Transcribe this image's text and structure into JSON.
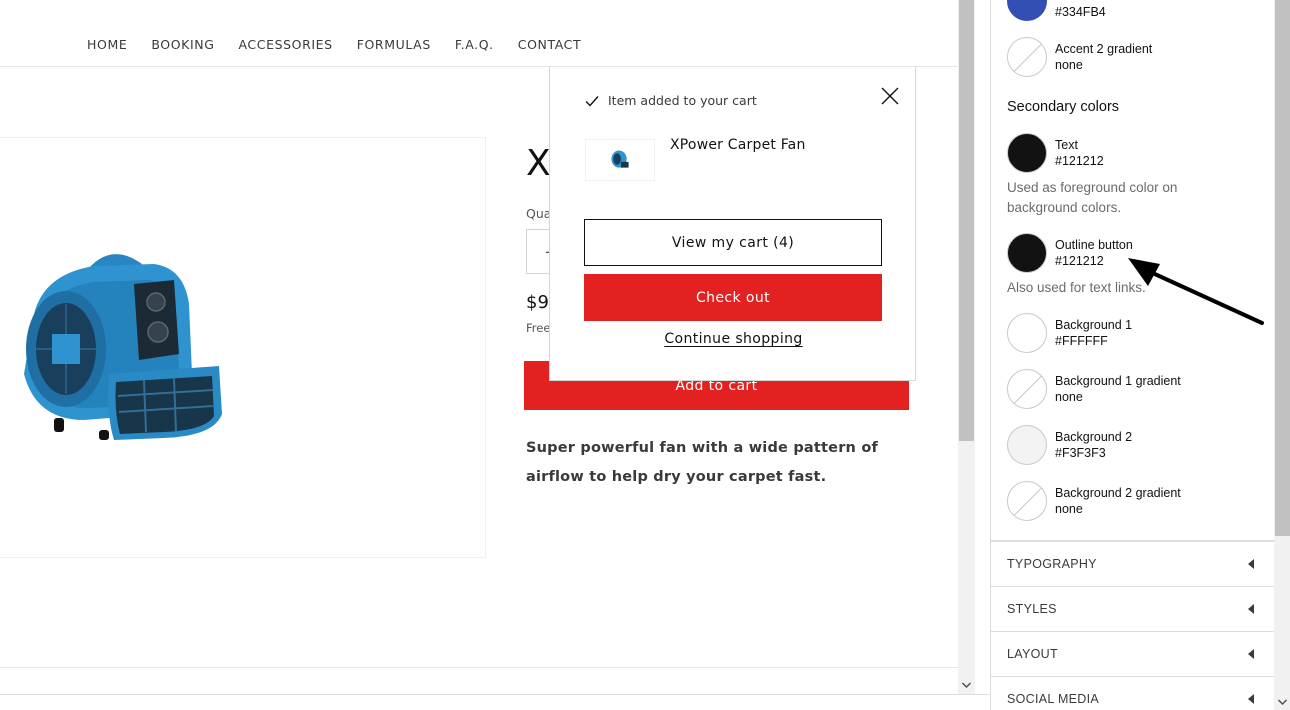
{
  "nav": {
    "items": [
      "HOME",
      "BOOKING",
      "ACCESSORIES",
      "FORMULAS",
      "F.A.Q.",
      "CONTACT"
    ]
  },
  "product": {
    "title_visible": "X",
    "quantity_label_visible": "Qua",
    "quantity_minus": "-",
    "price_visible": "$9.",
    "shipping_visible": "Free",
    "add_to_cart": "Add to cart",
    "description": "Super powerful fan with a wide pattern of airflow to help dry your carpet fast."
  },
  "cart_popup": {
    "added_message": "Item added to your cart",
    "item_name": "XPower Carpet Fan",
    "view_cart": "View my cart (4)",
    "checkout": "Check out",
    "continue_shopping": "Continue shopping"
  },
  "settings_panel": {
    "top_swatch_value": "#334FB4",
    "accent2_gradient": {
      "name": "Accent 2 gradient",
      "value": "none"
    },
    "secondary_heading": "Secondary colors",
    "text_color": {
      "name": "Text",
      "value": "#121212",
      "help": "Used as foreground color on background colors."
    },
    "outline_button": {
      "name": "Outline button",
      "value": "#121212",
      "help": "Also used for text links."
    },
    "background1": {
      "name": "Background 1",
      "value": "#FFFFFF"
    },
    "background1_gradient": {
      "name": "Background 1 gradient",
      "value": "none"
    },
    "background2": {
      "name": "Background 2",
      "value": "#F3F3F3"
    },
    "background2_gradient": {
      "name": "Background 2 gradient",
      "value": "none"
    },
    "sections": [
      "TYPOGRAPHY",
      "STYLES",
      "LAYOUT",
      "SOCIAL MEDIA"
    ]
  },
  "colors": {
    "accent_red": "#e32121",
    "swatch_blue": "#334FB4",
    "swatch_dark": "#121212",
    "swatch_white": "#FFFFFF",
    "swatch_light": "#F3F3F3"
  },
  "icons": {
    "check": "check-icon",
    "close": "close-icon",
    "caret": "caret-left-icon",
    "scroll_down": "scroll-down-arrow-icon",
    "annotation": "annotation-arrow"
  }
}
